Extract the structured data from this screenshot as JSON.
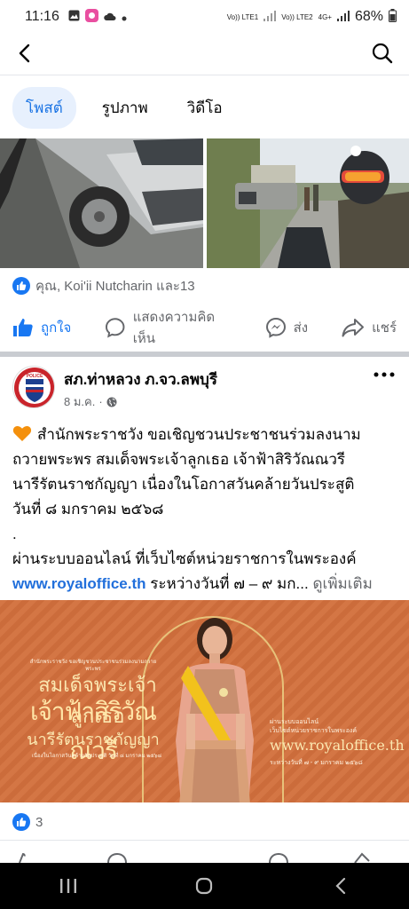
{
  "status_bar": {
    "time": "11:16",
    "sim1": "Vo)) LTE1",
    "sim2": "Vo)) LTE2",
    "net": "4G+",
    "battery": "68%"
  },
  "tabs": [
    {
      "label": "โพสต์",
      "active": true
    },
    {
      "label": "รูปภาพ",
      "active": false
    },
    {
      "label": "วิดีโอ",
      "active": false
    }
  ],
  "first_post": {
    "reactions_text": "คุณ, Koi'ii Nutcharin และ13"
  },
  "actions": {
    "like": "ถูกใจ",
    "comment": "แสดงความคิดเห็น",
    "send": "ส่ง",
    "share": "แชร์"
  },
  "second_post": {
    "page_name": "สภ.ท่าหลวง ภ.จว.ลพบุรี",
    "date": "8 ม.ค.",
    "dot": "·",
    "avatar_text": "POLICE",
    "text_lines": [
      "สำนักพระราชวัง ขอเชิญชวนประชาชนร่วมลงนาม",
      "ถวายพระพร สมเด็จพระเจ้าลูกเธอ เจ้าฟ้าสิริวัณณวรี",
      "นารีรัตนราชกัญญา เนื่องในโอกาสวันคล้ายวันประสูติ",
      "วันที่ ๘ มกราคม ๒๕๖๘",
      ".",
      "ผ่านระบบออนไลน์ ที่เว็บไซต์หน่วยราชการในพระองค์"
    ],
    "link": "www.royaloffice.th",
    "link_tail": " ระหว่างวันที่ ๗ – ๙ มก...",
    "see_more": "ดูเพิ่มเติม",
    "banner": {
      "top_caption": "สำนักพระราชวัง ขอเชิญชวนประชาชนร่วมลงนามถวายพระพร",
      "line1": "สมเด็จพระเจ้าลูกเธอ",
      "line2": "เจ้าฟ้าสิริวัณณวรี",
      "line3": "นารีรัตนราชกัญญา",
      "subline": "เนื่องในโอกาสวันคล้ายวันประสูติ วันที่ ๘ มกราคม ๒๕๖๘",
      "right1": "ผ่านระบบออนไลน์",
      "right2": "เว็บไซต์หน่วยราชการในพระองค์",
      "right_url": "www.royaloffice.th",
      "right3": "ระหว่างวันที่ ๗ - ๙ มกราคม ๒๕๖๘"
    },
    "reaction_count": "3"
  },
  "colors": {
    "brand_blue": "#1877f2",
    "tab_active_bg": "#e7f0fd",
    "banner_bg": "#d2703d"
  }
}
